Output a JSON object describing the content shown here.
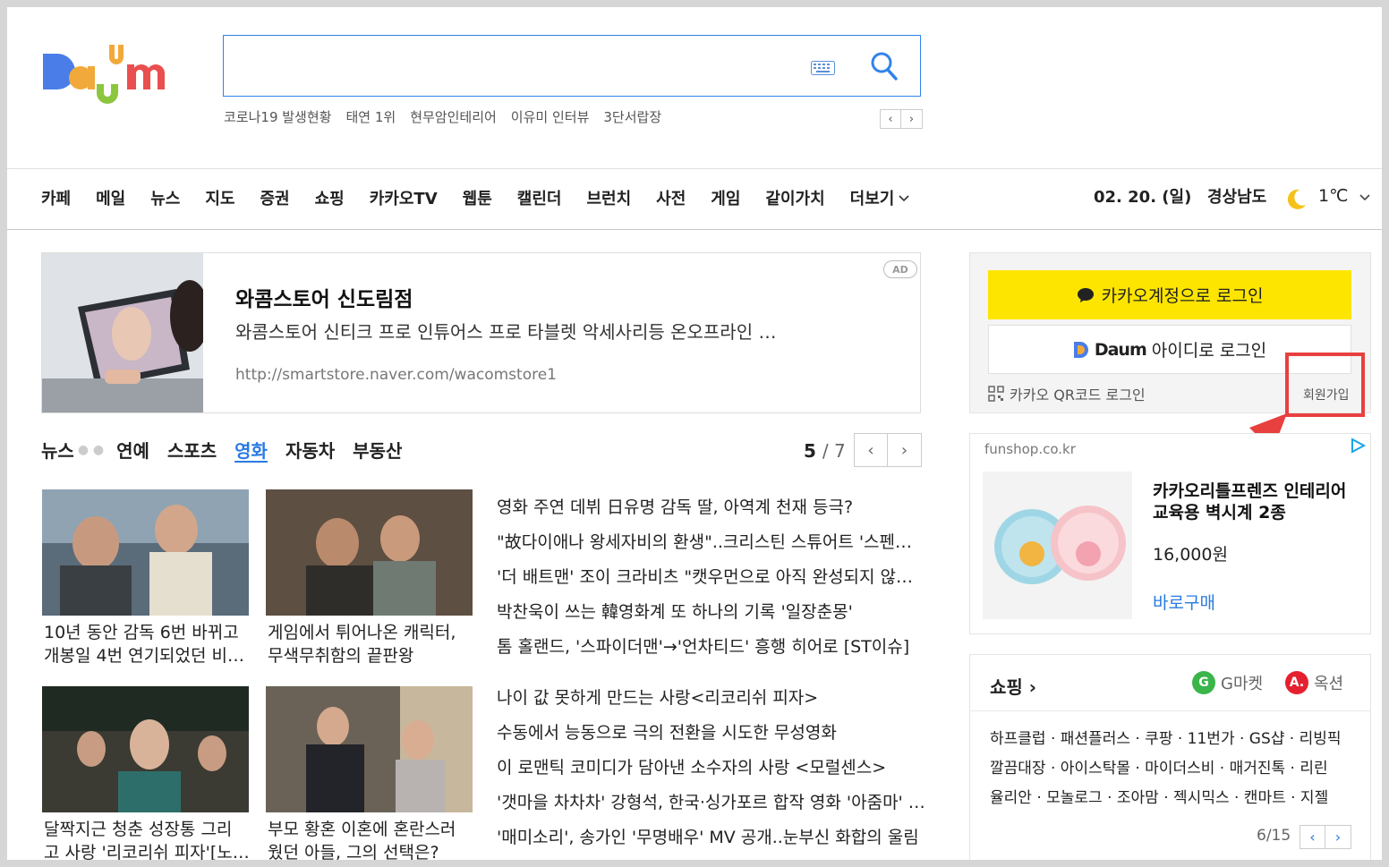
{
  "header": {
    "logo_text": "Daum",
    "search": {
      "value": "",
      "placeholder": ""
    },
    "trending": [
      "코로나19 발생현황",
      "태연 1위",
      "현무암인테리어",
      "이유미 인터뷰",
      "3단서랍장"
    ],
    "trend_prev": "‹",
    "trend_next": "›"
  },
  "nav": {
    "items": [
      "카페",
      "메일",
      "뉴스",
      "지도",
      "증권",
      "쇼핑",
      "카카오TV",
      "웹툰",
      "캘린더",
      "브런치",
      "사전",
      "게임",
      "같이가치"
    ],
    "more": "더보기",
    "date": "02. 20. (일)",
    "region": "경상남도",
    "temperature": "1℃"
  },
  "ad_banner": {
    "title": "와콤스토어 신도림점",
    "description": "와콤스토어 신티크 프로 인튜어스 프로 타블렛 악세사리등 온오프라인 …",
    "url": "http://smartstore.naver.com/wacomstore1",
    "badge": "AD"
  },
  "news": {
    "tabs": [
      {
        "label": "뉴스",
        "active": false
      },
      {
        "label": "연예",
        "active": false
      },
      {
        "label": "스포츠",
        "active": false
      },
      {
        "label": "영화",
        "active": true
      },
      {
        "label": "자동차",
        "active": false
      },
      {
        "label": "부동산",
        "active": false
      }
    ],
    "page_current": "5",
    "page_total": "/ 7",
    "cards": [
      {
        "line1": "10년 동안 감독 6번 바뀌고",
        "line2": "개봉일 4번 연기되었던 비…"
      },
      {
        "line1": "게임에서 튀어나온 캐릭터,",
        "line2": "무색무취함의 끝판왕"
      },
      {
        "line1": "달짝지근 청춘 성장통 그리",
        "line2": "고 사랑 '리코리쉬 피자'[노…"
      },
      {
        "line1": "부모 황혼 이혼에 혼란스러",
        "line2": "웠던 아들, 그의 선택은?"
      }
    ],
    "headlines_top": [
      "영화 주연 데뷔 日유명 감독 딸, 아역계 천재 등극?",
      "\"故다이애나 왕세자비의 환생\"..크리스틴 스튜어트 '스펜서'…",
      "'더 배트맨' 조이 크라비츠 \"캣우먼으로 아직 완성되지 않…",
      "박찬욱이 쓰는 韓영화계 또 하나의 기록 '일장춘몽'",
      "톰 홀랜드, '스파이더맨'→'언차티드' 흥행 히어로 [ST이슈]"
    ],
    "headlines_bottom": [
      "나이 값 못하게 만드는 사랑<리코리쉬 피자>",
      "수동에서 능동으로 극의 전환을 시도한 무성영화",
      "이 로맨틱 코미디가 담아낸 소수자의 사랑 <모럴센스>",
      "'갯마을 차차차' 강형석, 한국·싱가포르 합작 영화 '아줌마' …",
      "'매미소리', 송가인 '무명배우' MV 공개..눈부신 화합의 울림"
    ]
  },
  "login": {
    "kakao_label": "카카오계정으로 로그인",
    "daum_brand": "Daum",
    "daum_label": "아이디로 로그인",
    "qr_label": "카카오 QR코드 로그인",
    "join_label": "회원가입"
  },
  "shop_ad": {
    "source": "funshop.co.kr",
    "product_title": "카카오리틀프렌즈 인테리어 교육용 벽시계 2종",
    "price": "16,000원",
    "buy_label": "바로구매"
  },
  "shopping": {
    "title": "쇼핑 ›",
    "gmarket": "G마켓",
    "auction": "옥션",
    "links": [
      "하프클럽 · 패션플러스 · 쿠팡 · 11번가 · GS샵 · 리빙픽",
      "깔끔대장 · 아이스탁몰 · 마이더스비 · 매거진톡 · 리린",
      "율리안 · 모놀로그 · 조아맘 · 젝시믹스 · 캔마트 · 지젤"
    ],
    "page": "6/15"
  },
  "colors": {
    "accent_blue": "#2a7ae2",
    "kakao_yellow": "#fee500",
    "annotation_red": "#e8403f"
  },
  "icons": [
    "keyboard-icon",
    "search-icon",
    "moon-icon",
    "chevron-down-icon",
    "chat-bubble-icon",
    "qr-icon",
    "ad-choices-icon",
    "gmarket-icon",
    "auction-icon"
  ]
}
